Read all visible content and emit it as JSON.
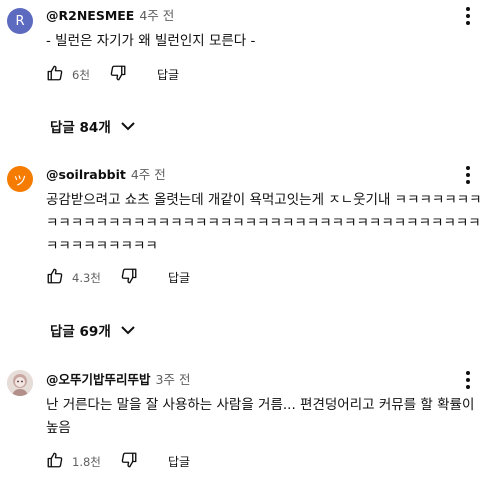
{
  "comments": [
    {
      "avatar_letter": "R",
      "avatar_color": "#5c6bc0",
      "author": "@R2NESMEE",
      "time": "4주 전",
      "text": "- 빌런은 자기가 왜 빌런인지 모른다 -",
      "likes": "6천",
      "reply_label": "답글",
      "replies_label": "답글 84개"
    },
    {
      "avatar_letter": "ツ",
      "avatar_color": "#f57c00",
      "author": "@soilrabbit",
      "time": "4주 전",
      "text": "공감받으려고 쇼츠 올렷는데 개같이 욕먹고잇는게 ㅈㄴ웃기내 ㅋㅋㅋㅋㅋㅋㅋㅋㅋㅋㅋㅋㅋㅋㅋㅋㅋㅋㅋㅋㅋㅋㅋㅋㅋㅋㅋㅋㅋㅋㅋㅋㅋㅋㅋㅋㅋㅋㅋㅋㅋㅋㅋㅋㅋㅋㅋㅋㅋㅋㅋ",
      "likes": "4.3천",
      "reply_label": "답글",
      "replies_label": "답글 69개"
    },
    {
      "avatar_letter": "",
      "avatar_color": "#d8c9c4",
      "author": "@오뚜기밥뚜리뚜밥",
      "time": "3주 전",
      "text": "난 거른다는 말을 잘 사용하는 사람을 거름... 편견덩어리고 커뮤를 할 확률이 높음",
      "likes": "1.8천",
      "reply_label": "답글"
    }
  ]
}
